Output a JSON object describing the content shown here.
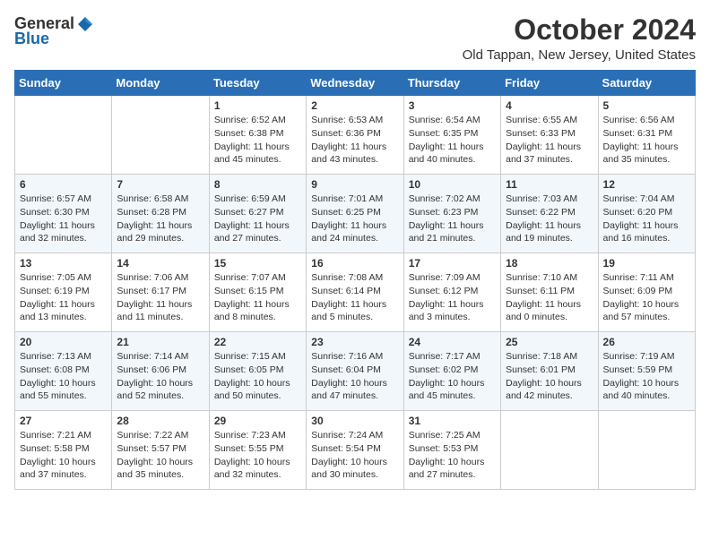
{
  "header": {
    "logo": {
      "general": "General",
      "blue": "Blue"
    },
    "title": "October 2024",
    "location": "Old Tappan, New Jersey, United States"
  },
  "weekdays": [
    "Sunday",
    "Monday",
    "Tuesday",
    "Wednesday",
    "Thursday",
    "Friday",
    "Saturday"
  ],
  "weeks": [
    [
      {
        "day": "",
        "info": ""
      },
      {
        "day": "",
        "info": ""
      },
      {
        "day": "1",
        "info": "Sunrise: 6:52 AM\nSunset: 6:38 PM\nDaylight: 11 hours and 45 minutes."
      },
      {
        "day": "2",
        "info": "Sunrise: 6:53 AM\nSunset: 6:36 PM\nDaylight: 11 hours and 43 minutes."
      },
      {
        "day": "3",
        "info": "Sunrise: 6:54 AM\nSunset: 6:35 PM\nDaylight: 11 hours and 40 minutes."
      },
      {
        "day": "4",
        "info": "Sunrise: 6:55 AM\nSunset: 6:33 PM\nDaylight: 11 hours and 37 minutes."
      },
      {
        "day": "5",
        "info": "Sunrise: 6:56 AM\nSunset: 6:31 PM\nDaylight: 11 hours and 35 minutes."
      }
    ],
    [
      {
        "day": "6",
        "info": "Sunrise: 6:57 AM\nSunset: 6:30 PM\nDaylight: 11 hours and 32 minutes."
      },
      {
        "day": "7",
        "info": "Sunrise: 6:58 AM\nSunset: 6:28 PM\nDaylight: 11 hours and 29 minutes."
      },
      {
        "day": "8",
        "info": "Sunrise: 6:59 AM\nSunset: 6:27 PM\nDaylight: 11 hours and 27 minutes."
      },
      {
        "day": "9",
        "info": "Sunrise: 7:01 AM\nSunset: 6:25 PM\nDaylight: 11 hours and 24 minutes."
      },
      {
        "day": "10",
        "info": "Sunrise: 7:02 AM\nSunset: 6:23 PM\nDaylight: 11 hours and 21 minutes."
      },
      {
        "day": "11",
        "info": "Sunrise: 7:03 AM\nSunset: 6:22 PM\nDaylight: 11 hours and 19 minutes."
      },
      {
        "day": "12",
        "info": "Sunrise: 7:04 AM\nSunset: 6:20 PM\nDaylight: 11 hours and 16 minutes."
      }
    ],
    [
      {
        "day": "13",
        "info": "Sunrise: 7:05 AM\nSunset: 6:19 PM\nDaylight: 11 hours and 13 minutes."
      },
      {
        "day": "14",
        "info": "Sunrise: 7:06 AM\nSunset: 6:17 PM\nDaylight: 11 hours and 11 minutes."
      },
      {
        "day": "15",
        "info": "Sunrise: 7:07 AM\nSunset: 6:15 PM\nDaylight: 11 hours and 8 minutes."
      },
      {
        "day": "16",
        "info": "Sunrise: 7:08 AM\nSunset: 6:14 PM\nDaylight: 11 hours and 5 minutes."
      },
      {
        "day": "17",
        "info": "Sunrise: 7:09 AM\nSunset: 6:12 PM\nDaylight: 11 hours and 3 minutes."
      },
      {
        "day": "18",
        "info": "Sunrise: 7:10 AM\nSunset: 6:11 PM\nDaylight: 11 hours and 0 minutes."
      },
      {
        "day": "19",
        "info": "Sunrise: 7:11 AM\nSunset: 6:09 PM\nDaylight: 10 hours and 57 minutes."
      }
    ],
    [
      {
        "day": "20",
        "info": "Sunrise: 7:13 AM\nSunset: 6:08 PM\nDaylight: 10 hours and 55 minutes."
      },
      {
        "day": "21",
        "info": "Sunrise: 7:14 AM\nSunset: 6:06 PM\nDaylight: 10 hours and 52 minutes."
      },
      {
        "day": "22",
        "info": "Sunrise: 7:15 AM\nSunset: 6:05 PM\nDaylight: 10 hours and 50 minutes."
      },
      {
        "day": "23",
        "info": "Sunrise: 7:16 AM\nSunset: 6:04 PM\nDaylight: 10 hours and 47 minutes."
      },
      {
        "day": "24",
        "info": "Sunrise: 7:17 AM\nSunset: 6:02 PM\nDaylight: 10 hours and 45 minutes."
      },
      {
        "day": "25",
        "info": "Sunrise: 7:18 AM\nSunset: 6:01 PM\nDaylight: 10 hours and 42 minutes."
      },
      {
        "day": "26",
        "info": "Sunrise: 7:19 AM\nSunset: 5:59 PM\nDaylight: 10 hours and 40 minutes."
      }
    ],
    [
      {
        "day": "27",
        "info": "Sunrise: 7:21 AM\nSunset: 5:58 PM\nDaylight: 10 hours and 37 minutes."
      },
      {
        "day": "28",
        "info": "Sunrise: 7:22 AM\nSunset: 5:57 PM\nDaylight: 10 hours and 35 minutes."
      },
      {
        "day": "29",
        "info": "Sunrise: 7:23 AM\nSunset: 5:55 PM\nDaylight: 10 hours and 32 minutes."
      },
      {
        "day": "30",
        "info": "Sunrise: 7:24 AM\nSunset: 5:54 PM\nDaylight: 10 hours and 30 minutes."
      },
      {
        "day": "31",
        "info": "Sunrise: 7:25 AM\nSunset: 5:53 PM\nDaylight: 10 hours and 27 minutes."
      },
      {
        "day": "",
        "info": ""
      },
      {
        "day": "",
        "info": ""
      }
    ]
  ]
}
